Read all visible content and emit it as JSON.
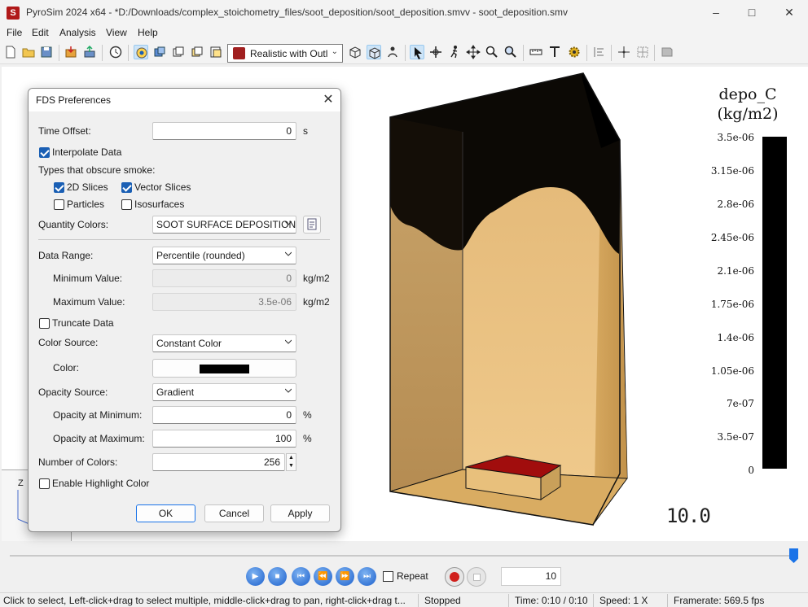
{
  "window": {
    "title": "PyroSim 2024 x64 - *D:/Downloads/complex_stoichometry_files/soot_deposition/soot_deposition.smvv - soot_deposition.smv",
    "app_icon_letter": "S"
  },
  "menu": [
    "File",
    "Edit",
    "Analysis",
    "View",
    "Help"
  ],
  "toolbar": {
    "render_mode": "Realistic with Outl",
    "icons": [
      "new-file-icon",
      "open-folder-icon",
      "save-icon",
      "import-icon",
      "export-icon",
      "timer-icon",
      "select-mode-icon",
      "render-icon",
      "copy-icon",
      "copy2-icon",
      "paste-icon",
      "render-mode-icon",
      "box-wire-icon",
      "box-solid-icon",
      "person-icon",
      "pointer-icon",
      "orbit-icon",
      "walk-icon",
      "pan-icon",
      "zoom-icon",
      "zoom-fit-icon",
      "measure-icon",
      "text-icon",
      "gear-icon",
      "align-icon",
      "snap-icon",
      "grid-icon",
      "reset-view-icon"
    ]
  },
  "legend": {
    "title_line1": "depo_C",
    "title_line2": "(kg/m2)",
    "ticks": [
      "3.5e-06",
      "3.15e-06",
      "2.8e-06",
      "2.45e-06",
      "2.1e-06",
      "1.75e-06",
      "1.4e-06",
      "1.05e-06",
      "7e-07",
      "3.5e-07",
      "0"
    ],
    "colorbar_color": "#000000"
  },
  "viewport": {
    "time_display": "10.0",
    "axis_label": "Z"
  },
  "dialog": {
    "title": "FDS Preferences",
    "time_offset_label": "Time Offset:",
    "time_offset_value": "0",
    "time_offset_unit": "s",
    "interpolate_label": "Interpolate Data",
    "interpolate_checked": true,
    "obscure_label": "Types that obscure smoke:",
    "slices2d_label": "2D Slices",
    "slices2d_checked": true,
    "vector_label": "Vector Slices",
    "vector_checked": true,
    "particles_label": "Particles",
    "particles_checked": false,
    "isosurfaces_label": "Isosurfaces",
    "isosurfaces_checked": false,
    "quantity_colors_label": "Quantity Colors:",
    "quantity_colors_value": "SOOT SURFACE DEPOSITION",
    "data_range_label": "Data Range:",
    "data_range_value": "Percentile (rounded)",
    "min_label": "Minimum Value:",
    "min_value": "0",
    "min_unit": "kg/m2",
    "max_label": "Maximum Value:",
    "max_value": "3.5e-06",
    "max_unit": "kg/m2",
    "truncate_label": "Truncate Data",
    "truncate_checked": false,
    "color_source_label": "Color Source:",
    "color_source_value": "Constant Color",
    "color_label": "Color:",
    "color_value": "#000000",
    "opacity_source_label": "Opacity Source:",
    "opacity_source_value": "Gradient",
    "opacity_min_label": "Opacity at Minimum:",
    "opacity_min_value": "0",
    "opacity_min_unit": "%",
    "opacity_max_label": "Opacity at Maximum:",
    "opacity_max_value": "100",
    "opacity_max_unit": "%",
    "num_colors_label": "Number of Colors:",
    "num_colors_value": "256",
    "highlight_label": "Enable Highlight Color",
    "highlight_checked": false,
    "ok_label": "OK",
    "cancel_label": "Cancel",
    "apply_label": "Apply"
  },
  "playback": {
    "repeat_label": "Repeat",
    "repeat_checked": false,
    "frame_value": "10",
    "timeline_position_fraction": 1.0
  },
  "status": {
    "hint": "Click to select, Left-click+drag to select multiple, middle-click+drag to pan, right-click+drag t...",
    "state": "Stopped",
    "time": "Time: 0:10 / 0:10",
    "speed": "Speed: 1 X",
    "framerate": "Framerate: 569.5 fps"
  }
}
